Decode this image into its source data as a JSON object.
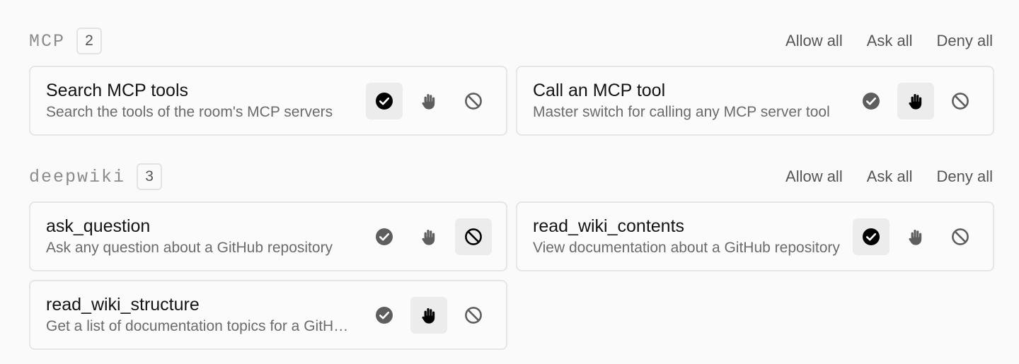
{
  "sections": [
    {
      "title": "MCP",
      "count": "2",
      "actions": {
        "allow_all": "Allow all",
        "ask_all": "Ask all",
        "deny_all": "Deny all"
      },
      "tools": [
        {
          "name": "Search MCP tools",
          "description": "Search the tools of the room's MCP servers",
          "selected": "allow"
        },
        {
          "name": "Call an MCP tool",
          "description": "Master switch for calling any MCP server tool",
          "selected": "ask"
        }
      ]
    },
    {
      "title": "deepwiki",
      "count": "3",
      "actions": {
        "allow_all": "Allow all",
        "ask_all": "Ask all",
        "deny_all": "Deny all"
      },
      "tools": [
        {
          "name": "ask_question",
          "description": "Ask any question about a GitHub repository",
          "selected": "deny"
        },
        {
          "name": "read_wiki_contents",
          "description": "View documentation about a GitHub repository",
          "selected": "allow"
        },
        {
          "name": "read_wiki_structure",
          "description": "Get a list of documentation topics for a GitHub repository",
          "selected": "ask"
        }
      ]
    }
  ],
  "icons": {
    "allow": "check-circle-icon",
    "ask": "hand-icon",
    "deny": "ban-icon"
  }
}
